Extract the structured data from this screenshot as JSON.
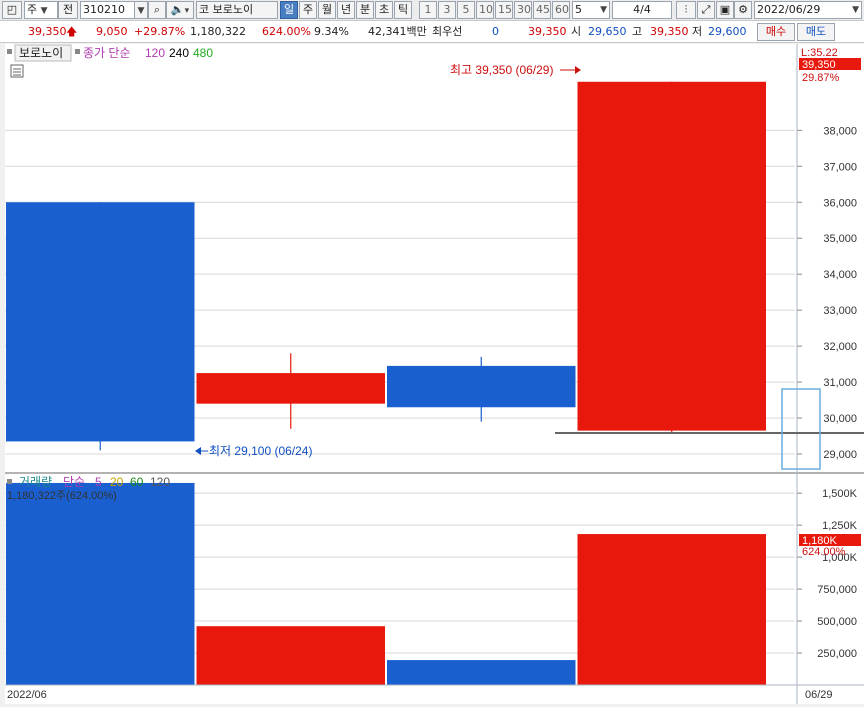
{
  "toolbar": {
    "market_type": "주",
    "prev_label": "전",
    "code": "310210",
    "market_badge": "코",
    "stock_name": "보로노이",
    "periods": [
      "일",
      "주",
      "월",
      "년",
      "분",
      "초",
      "틱"
    ],
    "selected_period": "일",
    "intervals": [
      "1",
      "3",
      "5",
      "10",
      "15",
      "30",
      "45",
      "60"
    ],
    "count_value": "5",
    "page": "4/4",
    "date": "2022/06/29"
  },
  "infobar": {
    "price": "39,350",
    "change": "9,050",
    "change_pct": "+29.87%",
    "volume": "1,180,322",
    "volume_ratio": "624.00%",
    "turnover": "9.34%",
    "amount": "42,341백만",
    "priority_label": "최우선",
    "priority_value": "0",
    "priority_price": "39,350",
    "open_label": "시",
    "open_value": "29,650",
    "high_label": "고",
    "high_value": "39,350",
    "low_label": "저",
    "low_value": "29,600",
    "buy_label": "매수",
    "sell_label": "매도"
  },
  "price_panel": {
    "name": "보로노이",
    "ma_label": "종가 단순",
    "ma_periods": [
      "120",
      "240",
      "480"
    ],
    "ma_colors": [
      "#b03cb0",
      "#000000",
      "#22aa22"
    ],
    "y_top_label": "L:35.22",
    "current_price_label": "39,350",
    "current_pct_label": "29.87%",
    "high_annotation": "최고 39,350 (06/29)",
    "low_annotation": "최저 29,100 (06/24)"
  },
  "volume_panel": {
    "name": "거래량",
    "ma_label": "단순",
    "ma_periods": [
      "5",
      "20",
      "60",
      "120"
    ],
    "ma_colors": [
      "#b03cb0",
      "#c8a000",
      "#1a8a1a",
      "#555555"
    ],
    "volume_label": "1,180,322주(624.00%)",
    "current_volume_label": "1,180K",
    "current_pct_label": "624.00%"
  },
  "x_axis": {
    "left_label": "2022/06",
    "right_label": "06/29"
  },
  "colors": {
    "up": "#e8190c",
    "down": "#1a5fd0",
    "axis_text": "#333333",
    "grid": "#d8d8d8"
  },
  "chart_data": {
    "type": "candlestick",
    "candles": [
      {
        "open": 36000,
        "close": 29350,
        "high": 36000,
        "low": 29100,
        "volume": 1580000,
        "direction": "down"
      },
      {
        "open": 30400,
        "close": 31250,
        "high": 31800,
        "low": 29700,
        "volume": 460000,
        "direction": "up"
      },
      {
        "open": 31450,
        "close": 30300,
        "high": 31700,
        "low": 29900,
        "volume": 195000,
        "direction": "down"
      },
      {
        "open": 29650,
        "close": 39350,
        "high": 39350,
        "low": 29600,
        "volume": 1180322,
        "direction": "up"
      }
    ],
    "price_ticks": [
      "29,000",
      "30,000",
      "31,000",
      "32,000",
      "33,000",
      "34,000",
      "35,000",
      "36,000",
      "37,000",
      "38,000"
    ],
    "price_tick_values": [
      29000,
      30000,
      31000,
      32000,
      33000,
      34000,
      35000,
      36000,
      37000,
      38000
    ],
    "volume_ticks": [
      "250,000",
      "500,000",
      "750,000",
      "1,000K",
      "1,250K",
      "1,500K"
    ],
    "volume_tick_values": [
      250000,
      500000,
      750000,
      1000000,
      1250000,
      1500000
    ],
    "price_range": [
      28500,
      40400
    ],
    "volume_range": [
      0,
      1650000
    ]
  }
}
